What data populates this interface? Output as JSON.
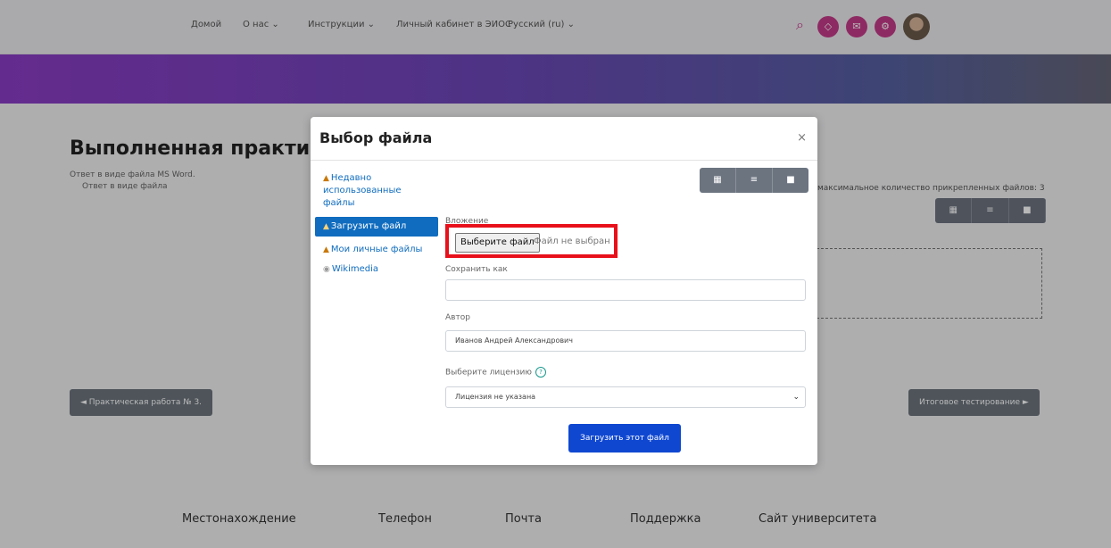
{
  "nav": {
    "home": "Домой",
    "about": "О нас ⌄",
    "instructions": "Инструкции ⌄",
    "cabinet": "Личный кабинет в ЭИОС",
    "language": "Русский (ru) ⌄"
  },
  "page": {
    "title": "Выполненная практическая",
    "sub1": "Ответ в виде файла MS Word.",
    "sub2": "Ответ в виде файла",
    "max_files": "максимальное количество прикрепленных файлов: 3",
    "prev_button": "◄ Практическая работа № 3.",
    "next_button": "Итоговое тестирование ►"
  },
  "footer": {
    "location": "Местонахождение",
    "phone": "Телефон",
    "mail": "Почта",
    "support": "Поддержка",
    "site": "Сайт университета"
  },
  "modal": {
    "title": "Выбор файла",
    "close": "×",
    "repos": [
      {
        "label": "Недавно использованные файлы"
      },
      {
        "label": "Загрузить файл"
      },
      {
        "label": "Мои личные файлы"
      },
      {
        "label": "Wikimedia"
      }
    ],
    "attachment_label": "Вложение",
    "choose_file": "Выберите файл",
    "no_file": "Файл не выбран",
    "save_as_label": "Сохранить как",
    "save_as_value": "",
    "author_label": "Автор",
    "author_value": "Иванов Андрей Александрович",
    "license_label": "Выберите лицензию",
    "license_value": "Лицензия не указана",
    "upload_button": "Загрузить этот файл"
  },
  "colors": {
    "accent": "#0f6cbf",
    "upload_button": "#0f47d1",
    "highlight_box": "#e8101a",
    "nav_icons": "#c53b8a"
  }
}
